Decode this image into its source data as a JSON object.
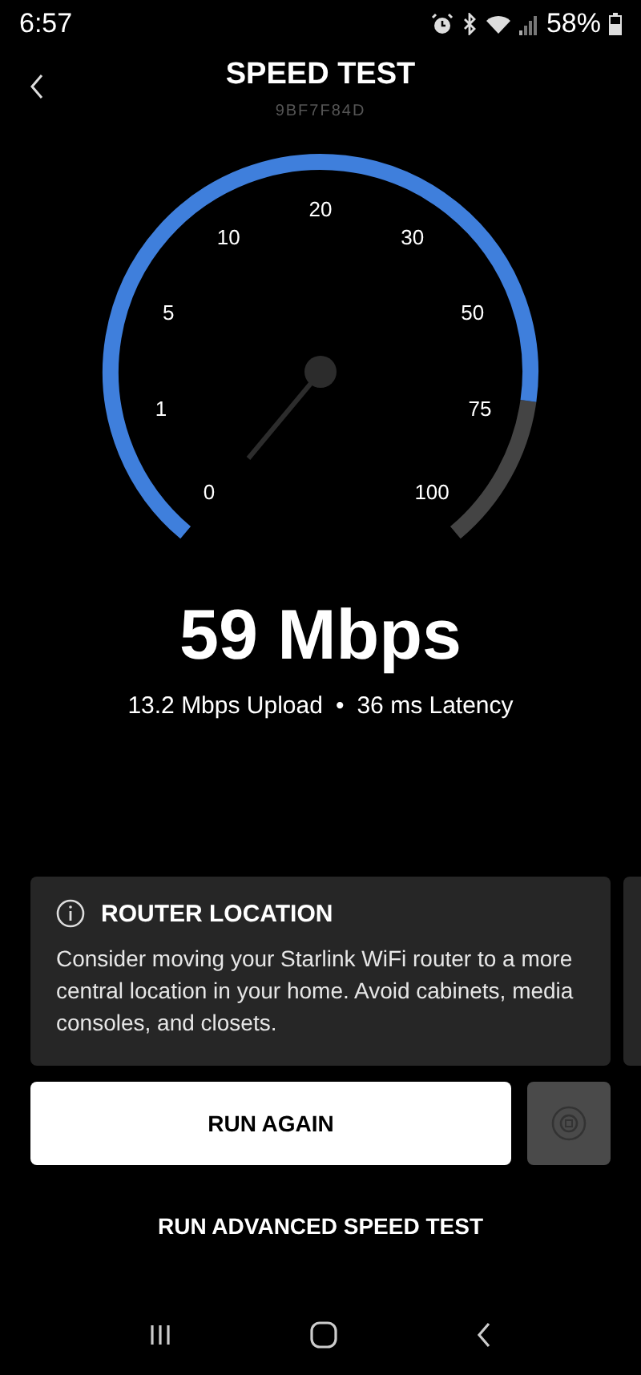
{
  "status_bar": {
    "time": "6:57",
    "battery": "58%"
  },
  "header": {
    "title": "SPEED TEST",
    "subtitle": "9BF7F84D"
  },
  "gauge": {
    "ticks": [
      "0",
      "1",
      "5",
      "10",
      "20",
      "30",
      "50",
      "75",
      "100"
    ]
  },
  "result": {
    "speed": "59 Mbps",
    "upload": "13.2 Mbps Upload",
    "separator": "•",
    "latency": "36 ms Latency"
  },
  "tip_card": {
    "title": "ROUTER LOCATION",
    "body": "Consider moving your Starlink WiFi router to a more central location in your home. Avoid cabinets, media consoles, and closets."
  },
  "buttons": {
    "primary": "RUN AGAIN",
    "link": "RUN ADVANCED SPEED TEST"
  }
}
